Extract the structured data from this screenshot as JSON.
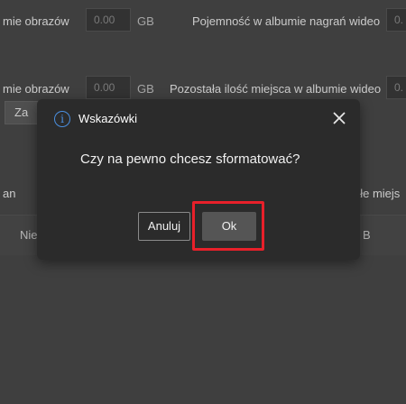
{
  "background": {
    "row1": {
      "label_left": "mie obrazów",
      "value_left": "0.00",
      "unit_left": "GB",
      "label_right": "Pojemność w albumie nagrań wideo",
      "value_right_partial": "0."
    },
    "row2": {
      "label_left": "mie obrazów",
      "value_left": "0.00",
      "unit_left": "GB",
      "label_right": "Pozostała ilość miejsca w albumie wideo",
      "value_right_partial": "0."
    },
    "button_partial": "Za",
    "table": {
      "header_left": "an",
      "header_right": "ałe miejs",
      "row_left": "Nie",
      "row_right": "B"
    }
  },
  "dialog": {
    "title": "Wskazówki",
    "info_glyph": "i",
    "message": "Czy na pewno chcesz sformatować?",
    "cancel_label": "Anuluj",
    "ok_label": "Ok",
    "highlight_color": "#e8202a"
  }
}
